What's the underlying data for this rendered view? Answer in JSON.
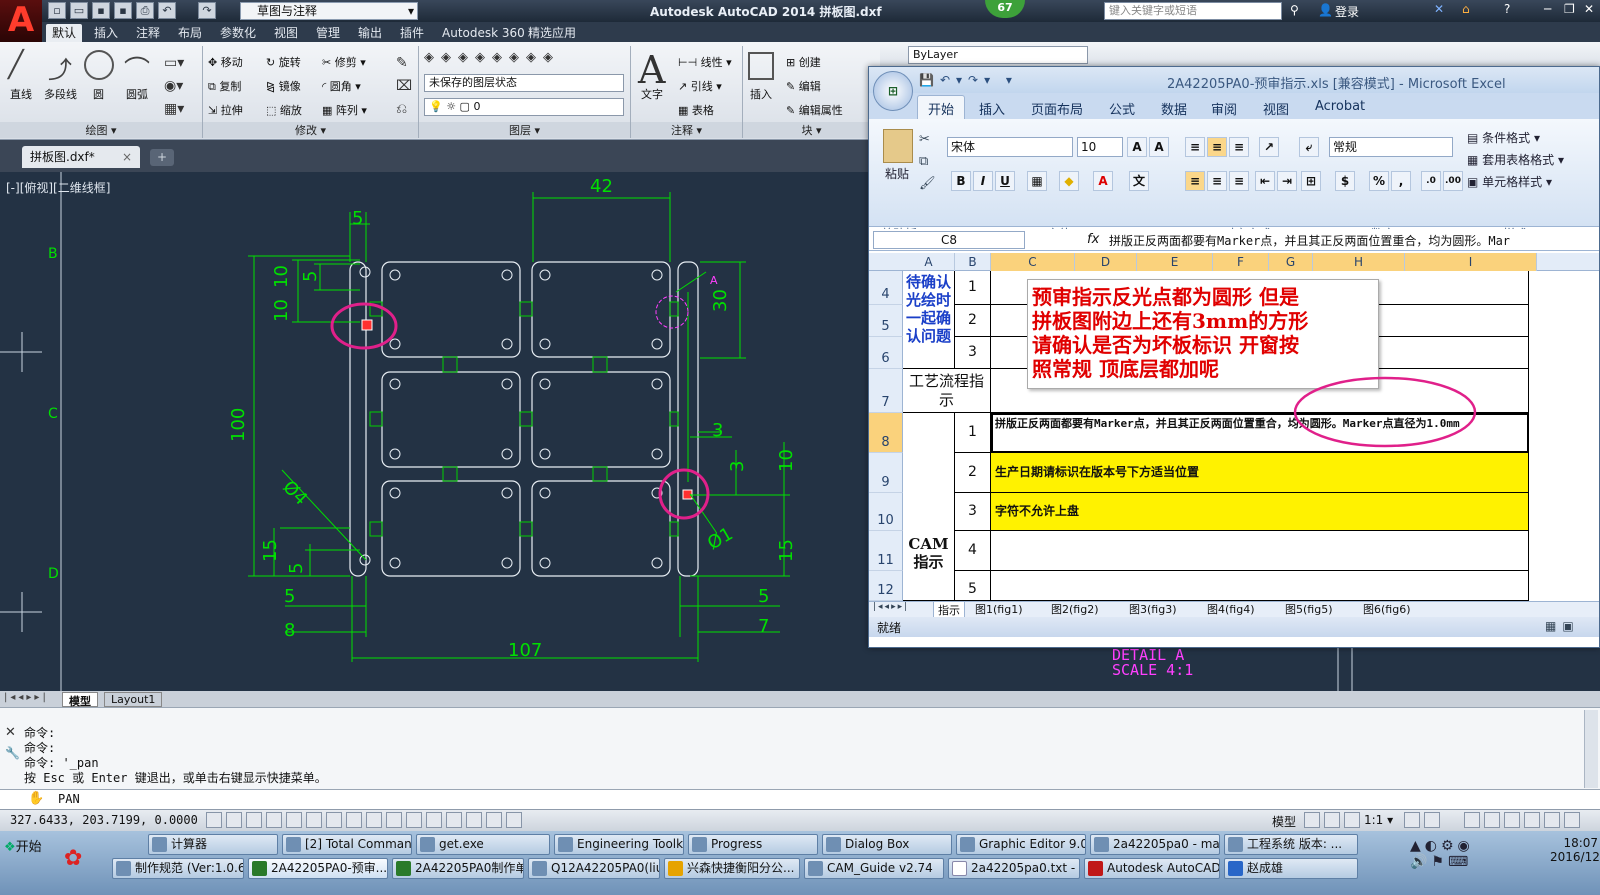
{
  "app": {
    "title": "Autodesk AutoCAD 2014    拼板图.dxf",
    "logo": "A",
    "workspace": "草图与注释",
    "badge": "67",
    "search_placeholder": "键入关键字或短语",
    "login": "登录"
  },
  "ribbon_tabs": [
    "默认",
    "插入",
    "注释",
    "布局",
    "参数化",
    "视图",
    "管理",
    "输出",
    "插件",
    "Autodesk 360",
    "精选应用"
  ],
  "ribbon": {
    "draw": [
      "直线",
      "多段线",
      "圆",
      "圆弧"
    ],
    "modify_rows": [
      [
        "移动",
        "旋转",
        "修剪"
      ],
      [
        "复制",
        "镜像",
        "圆角"
      ],
      [
        "拉伸",
        "缩放",
        "阵列"
      ]
    ],
    "layer_combo": "未保存的图层状态",
    "layer_value": "0",
    "text": "文字",
    "annot": [
      "线性",
      "引线",
      "表格"
    ],
    "insert": "插入",
    "block": [
      "创建",
      "编辑",
      "编辑属性"
    ],
    "bylayer": "ByLayer",
    "panels": [
      "绘图",
      "修改",
      "图层",
      "注释",
      "块"
    ]
  },
  "doc_tab": "拼板图.dxf*",
  "view_label": "[-][俯视][二维线框]",
  "drawing": {
    "dims": [
      "42",
      "5",
      "10",
      "10",
      "5",
      "10",
      "30",
      "100",
      "3",
      "3",
      "10",
      "15",
      "5",
      "15",
      "5",
      "8",
      "107",
      "5",
      "7"
    ],
    "diameters": [
      "Ø4",
      "Ø1"
    ],
    "detail_mark": "A",
    "row_letters": [
      "B",
      "C",
      "D"
    ],
    "detail_label": "DETAIL  A",
    "scale_label": "SCALE  4:1"
  },
  "layout_tabs": [
    "模型",
    "Layout1"
  ],
  "command": {
    "history": [
      "命令:",
      "命令:",
      "命令: '_pan",
      "按 Esc 或 Enter 键退出，或单击右键显示快捷菜单。"
    ],
    "input": "PAN"
  },
  "status": {
    "coords": "327.6433, 203.7199, 0.0000",
    "model": "模型",
    "scale": "1:1"
  },
  "excel": {
    "title": "2A42205PA0-预审指示.xls  [兼容模式] - Microsoft Excel",
    "tabs": [
      "开始",
      "插入",
      "页面布局",
      "公式",
      "数据",
      "审阅",
      "视图",
      "Acrobat"
    ],
    "font": "宋体",
    "font_size": "10",
    "number_format": "常规",
    "groups": [
      "剪贴板",
      "字体",
      "对齐方式",
      "数字",
      "样式"
    ],
    "paste": "粘贴",
    "styles": [
      "条件格式",
      "套用表格格式",
      "单元格样式"
    ],
    "cell_ref": "C8",
    "fx": "fx",
    "formula": "拼版正反两面都要有Marker点，并且其正反两面位置重合，均为圆形。Mar",
    "columns": [
      "A",
      "B",
      "C",
      "D",
      "E",
      "F",
      "G",
      "H",
      "I"
    ],
    "rows": [
      {
        "num": "4",
        "b": "1"
      },
      {
        "num": "5",
        "b": "2"
      },
      {
        "num": "6",
        "b": "3"
      },
      {
        "num": "7",
        "b": ""
      },
      {
        "num": "8",
        "b": "1",
        "c": "拼版正反两面都要有Marker点，并且其正反两面位置重合，均为圆形。Marker点直径为1.0mm"
      },
      {
        "num": "9",
        "b": "2",
        "c": "生产日期请标识在版本号下方适当位置"
      },
      {
        "num": "10",
        "b": "3",
        "c": "字符不允许上盘"
      },
      {
        "num": "11",
        "b": "4"
      },
      {
        "num": "12",
        "b": "5"
      }
    ],
    "a_labels": [
      "待确认光绘时一起确认问题",
      "工艺流程指示",
      "CAM指示"
    ],
    "annotation": [
      "预审指示反光点都为圆形  但是",
      "拼板图附边上还有3mm的方形",
      "请确认是否为坏板标识  开窗按",
      "照常规  顶底层都加呢"
    ],
    "sheets": [
      "指示",
      "图1(fig1)",
      "图2(fig2)",
      "图3(fig3)",
      "图4(fig4)",
      "图5(fig5)",
      "图6(fig6)"
    ],
    "status": "就绪"
  },
  "taskbar": {
    "start": "开始",
    "row1": [
      "计算器",
      "[2] Total Commande...",
      "get.exe",
      "Engineering Toolkit ...",
      "Progress",
      "Dialog Box",
      "Graphic Editor 9.07...",
      "2a42205pa0 - main...",
      "工程系统  版本: ..."
    ],
    "row2": [
      "制作规范 (Ver:1.0.6)",
      "2A42205PA0-预审...",
      "2A42205PA0制作单...",
      "Q12A42205PA0(liuw...",
      "兴森快捷衡阳分公...",
      "CAM_Guide v2.74",
      "2a42205pa0.txt - 记...",
      "Autodesk AutoCAD ...",
      "赵成雄"
    ],
    "time": "18:07",
    "date": "2016/12/9"
  },
  "colors": {
    "cad_green": "#00e000",
    "cad_bg": "#233244",
    "highlight": "#fff200",
    "circle": "#e0208a",
    "detail": "#ff40ff"
  }
}
